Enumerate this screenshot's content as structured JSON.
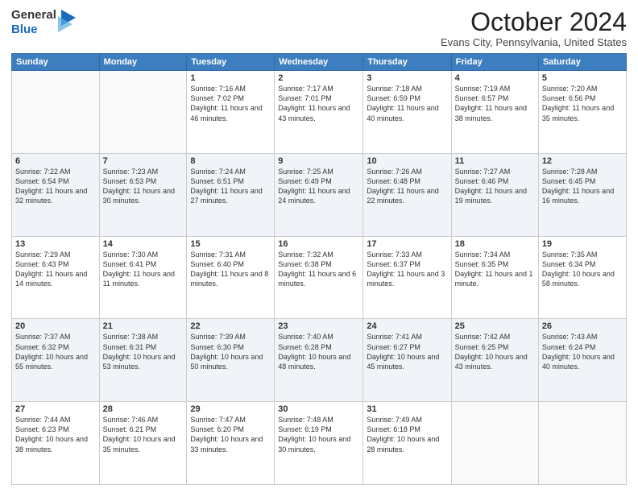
{
  "header": {
    "logo_line1": "General",
    "logo_line2": "Blue",
    "month": "October 2024",
    "location": "Evans City, Pennsylvania, United States"
  },
  "days_of_week": [
    "Sunday",
    "Monday",
    "Tuesday",
    "Wednesday",
    "Thursday",
    "Friday",
    "Saturday"
  ],
  "weeks": [
    [
      {
        "day": "",
        "info": ""
      },
      {
        "day": "",
        "info": ""
      },
      {
        "day": "1",
        "info": "Sunrise: 7:16 AM\nSunset: 7:02 PM\nDaylight: 11 hours and 46 minutes."
      },
      {
        "day": "2",
        "info": "Sunrise: 7:17 AM\nSunset: 7:01 PM\nDaylight: 11 hours and 43 minutes."
      },
      {
        "day": "3",
        "info": "Sunrise: 7:18 AM\nSunset: 6:59 PM\nDaylight: 11 hours and 40 minutes."
      },
      {
        "day": "4",
        "info": "Sunrise: 7:19 AM\nSunset: 6:57 PM\nDaylight: 11 hours and 38 minutes."
      },
      {
        "day": "5",
        "info": "Sunrise: 7:20 AM\nSunset: 6:56 PM\nDaylight: 11 hours and 35 minutes."
      }
    ],
    [
      {
        "day": "6",
        "info": "Sunrise: 7:22 AM\nSunset: 6:54 PM\nDaylight: 11 hours and 32 minutes."
      },
      {
        "day": "7",
        "info": "Sunrise: 7:23 AM\nSunset: 6:53 PM\nDaylight: 11 hours and 30 minutes."
      },
      {
        "day": "8",
        "info": "Sunrise: 7:24 AM\nSunset: 6:51 PM\nDaylight: 11 hours and 27 minutes."
      },
      {
        "day": "9",
        "info": "Sunrise: 7:25 AM\nSunset: 6:49 PM\nDaylight: 11 hours and 24 minutes."
      },
      {
        "day": "10",
        "info": "Sunrise: 7:26 AM\nSunset: 6:48 PM\nDaylight: 11 hours and 22 minutes."
      },
      {
        "day": "11",
        "info": "Sunrise: 7:27 AM\nSunset: 6:46 PM\nDaylight: 11 hours and 19 minutes."
      },
      {
        "day": "12",
        "info": "Sunrise: 7:28 AM\nSunset: 6:45 PM\nDaylight: 11 hours and 16 minutes."
      }
    ],
    [
      {
        "day": "13",
        "info": "Sunrise: 7:29 AM\nSunset: 6:43 PM\nDaylight: 11 hours and 14 minutes."
      },
      {
        "day": "14",
        "info": "Sunrise: 7:30 AM\nSunset: 6:41 PM\nDaylight: 11 hours and 11 minutes."
      },
      {
        "day": "15",
        "info": "Sunrise: 7:31 AM\nSunset: 6:40 PM\nDaylight: 11 hours and 8 minutes."
      },
      {
        "day": "16",
        "info": "Sunrise: 7:32 AM\nSunset: 6:38 PM\nDaylight: 11 hours and 6 minutes."
      },
      {
        "day": "17",
        "info": "Sunrise: 7:33 AM\nSunset: 6:37 PM\nDaylight: 11 hours and 3 minutes."
      },
      {
        "day": "18",
        "info": "Sunrise: 7:34 AM\nSunset: 6:35 PM\nDaylight: 11 hours and 1 minute."
      },
      {
        "day": "19",
        "info": "Sunrise: 7:35 AM\nSunset: 6:34 PM\nDaylight: 10 hours and 58 minutes."
      }
    ],
    [
      {
        "day": "20",
        "info": "Sunrise: 7:37 AM\nSunset: 6:32 PM\nDaylight: 10 hours and 55 minutes."
      },
      {
        "day": "21",
        "info": "Sunrise: 7:38 AM\nSunset: 6:31 PM\nDaylight: 10 hours and 53 minutes."
      },
      {
        "day": "22",
        "info": "Sunrise: 7:39 AM\nSunset: 6:30 PM\nDaylight: 10 hours and 50 minutes."
      },
      {
        "day": "23",
        "info": "Sunrise: 7:40 AM\nSunset: 6:28 PM\nDaylight: 10 hours and 48 minutes."
      },
      {
        "day": "24",
        "info": "Sunrise: 7:41 AM\nSunset: 6:27 PM\nDaylight: 10 hours and 45 minutes."
      },
      {
        "day": "25",
        "info": "Sunrise: 7:42 AM\nSunset: 6:25 PM\nDaylight: 10 hours and 43 minutes."
      },
      {
        "day": "26",
        "info": "Sunrise: 7:43 AM\nSunset: 6:24 PM\nDaylight: 10 hours and 40 minutes."
      }
    ],
    [
      {
        "day": "27",
        "info": "Sunrise: 7:44 AM\nSunset: 6:23 PM\nDaylight: 10 hours and 38 minutes."
      },
      {
        "day": "28",
        "info": "Sunrise: 7:46 AM\nSunset: 6:21 PM\nDaylight: 10 hours and 35 minutes."
      },
      {
        "day": "29",
        "info": "Sunrise: 7:47 AM\nSunset: 6:20 PM\nDaylight: 10 hours and 33 minutes."
      },
      {
        "day": "30",
        "info": "Sunrise: 7:48 AM\nSunset: 6:19 PM\nDaylight: 10 hours and 30 minutes."
      },
      {
        "day": "31",
        "info": "Sunrise: 7:49 AM\nSunset: 6:18 PM\nDaylight: 10 hours and 28 minutes."
      },
      {
        "day": "",
        "info": ""
      },
      {
        "day": "",
        "info": ""
      }
    ]
  ]
}
